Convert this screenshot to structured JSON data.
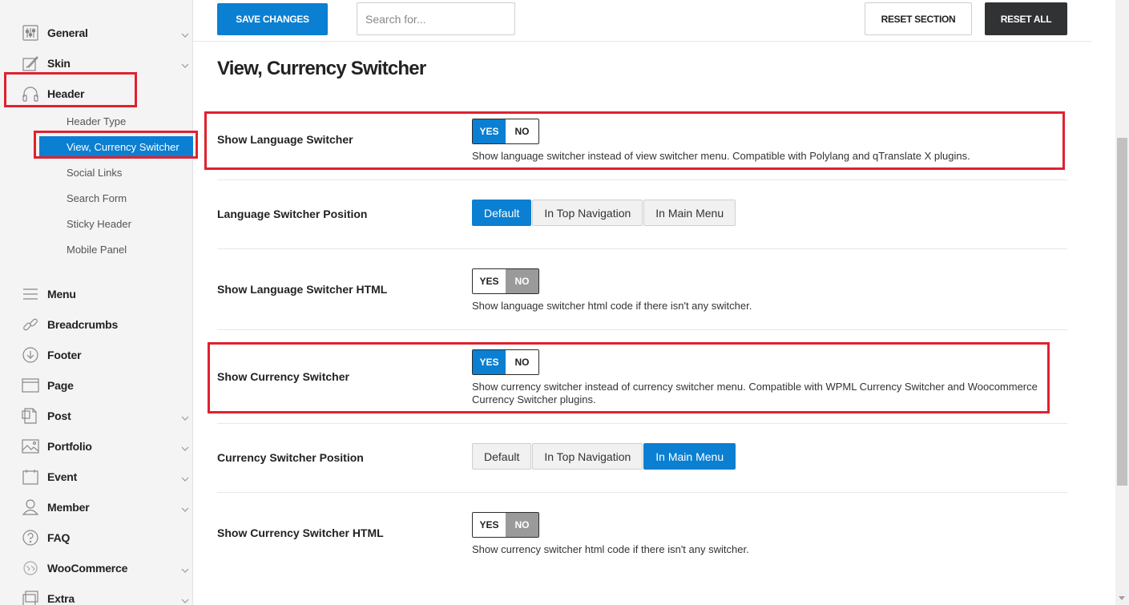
{
  "toolbar": {
    "save_label": "SAVE CHANGES",
    "search_placeholder": "Search for...",
    "reset_section_label": "RESET SECTION",
    "reset_all_label": "RESET ALL"
  },
  "sidebar": {
    "items": [
      {
        "label": "General",
        "icon": "sliders-icon"
      },
      {
        "label": "Skin",
        "icon": "brush-icon"
      },
      {
        "label": "Header",
        "icon": "headphones-icon"
      },
      {
        "label": "Menu",
        "icon": "menu-icon"
      },
      {
        "label": "Breadcrumbs",
        "icon": "link-icon"
      },
      {
        "label": "Footer",
        "icon": "arrow-down-circle-icon"
      },
      {
        "label": "Page",
        "icon": "browser-icon"
      },
      {
        "label": "Post",
        "icon": "document-icon"
      },
      {
        "label": "Portfolio",
        "icon": "image-icon"
      },
      {
        "label": "Event",
        "icon": "calendar-icon"
      },
      {
        "label": "Member",
        "icon": "user-icon"
      },
      {
        "label": "FAQ",
        "icon": "question-icon"
      },
      {
        "label": "WooCommerce",
        "icon": "woocommerce-icon"
      },
      {
        "label": "Extra",
        "icon": "extra-icon"
      }
    ],
    "sub_items": [
      {
        "label": "Header Type"
      },
      {
        "label": "View, Currency Switcher"
      },
      {
        "label": "Social Links"
      },
      {
        "label": "Search Form"
      },
      {
        "label": "Sticky Header"
      },
      {
        "label": "Mobile Panel"
      }
    ]
  },
  "main": {
    "title": "View, Currency Switcher",
    "rows": [
      {
        "label": "Show Language Switcher",
        "yes": "YES",
        "no": "NO",
        "desc": "Show language switcher instead of view switcher menu. Compatible with Polylang and qTranslate X plugins."
      },
      {
        "label": "Language Switcher Position",
        "options": [
          "Default",
          "In Top Navigation",
          "In Main Menu"
        ]
      },
      {
        "label": "Show Language Switcher HTML",
        "yes": "YES",
        "no": "NO",
        "desc": "Show language switcher html code if there isn't any switcher."
      },
      {
        "label": "Show Currency Switcher",
        "yes": "YES",
        "no": "NO",
        "desc": "Show currency switcher instead of currency switcher menu. Compatible with WPML Currency Switcher and Woocommerce Currency Switcher plugins."
      },
      {
        "label": "Currency Switcher Position",
        "options": [
          "Default",
          "In Top Navigation",
          "In Main Menu"
        ]
      },
      {
        "label": "Show Currency Switcher HTML",
        "yes": "YES",
        "no": "NO",
        "desc": "Show currency switcher html code if there isn't any switcher."
      }
    ]
  },
  "colors": {
    "accent": "#0b7fd1",
    "highlight": "#e0212f",
    "dark": "#303234"
  }
}
